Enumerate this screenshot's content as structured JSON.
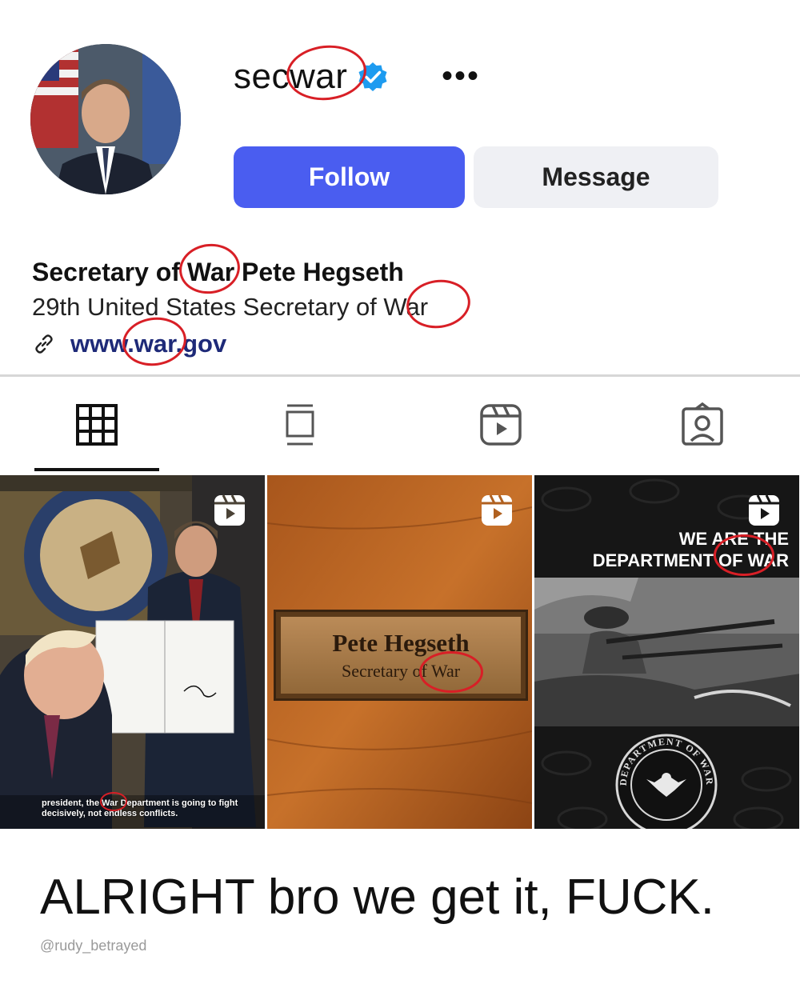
{
  "profile": {
    "username": "secwar",
    "more_label": "•••",
    "follow_label": "Follow",
    "message_label": "Message",
    "display_name": "Secretary of War Pete Hegseth",
    "bio_line": "29th United States Secretary of War",
    "link": "www.war.gov"
  },
  "tabs": [
    {
      "name": "posts",
      "icon": "grid-icon",
      "active": true
    },
    {
      "name": "guides",
      "icon": "feed-icon",
      "active": false
    },
    {
      "name": "reels",
      "icon": "reels-icon",
      "active": false
    },
    {
      "name": "tagged",
      "icon": "tagged-icon",
      "active": false
    }
  ],
  "posts": [
    {
      "type": "reel",
      "caption": "president, the War Department is going to fight decisively, not endless conflicts."
    },
    {
      "type": "reel",
      "plate_name": "Pete Hegseth",
      "plate_title": "Secretary of War"
    },
    {
      "type": "reel",
      "headline_line1": "WE ARE THE",
      "headline_line2": "DEPARTMENT OF WAR",
      "seal_text": "DEPARTMENT OF WAR"
    }
  ],
  "meme_caption": "ALRIGHT bro we get it, FUCK.",
  "credit": "@rudy_betrayed",
  "colors": {
    "accent": "#4a5df0",
    "verified": "#1d9bf0",
    "annotation": "#d81f26"
  }
}
